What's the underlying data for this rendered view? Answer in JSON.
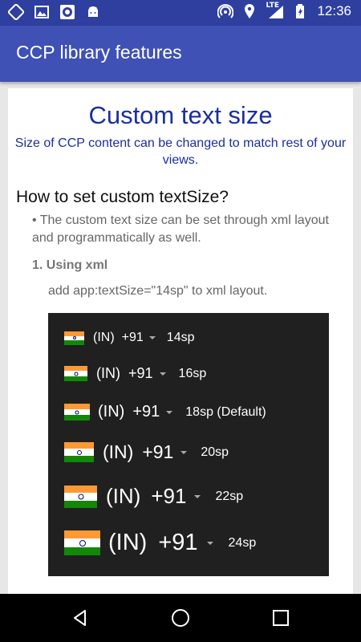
{
  "status_bar": {
    "time": "12:36",
    "network": "LTE",
    "left_icons": [
      "rotate-icon",
      "image-icon",
      "record-icon",
      "android-icon"
    ],
    "right_icons": [
      "hotspot-icon",
      "location-icon",
      "signal-icon",
      "battery-icon"
    ]
  },
  "app_bar": {
    "title": "CCP library features"
  },
  "content": {
    "heading": "Custom text size",
    "subheading": "Size of CCP content can be changed to match rest of your views.",
    "section_title": "How to set custom textSize?",
    "bullet": "• The custom text size can be set through xml layout and programmatically as well.",
    "step": "1. Using xml",
    "hint": "add app:textSize=\"14sp\" to xml layout."
  },
  "ccp_rows": [
    {
      "name_code": "(IN)",
      "phone_code": "+91",
      "size_label": "14sp"
    },
    {
      "name_code": "(IN)",
      "phone_code": "+91",
      "size_label": "16sp"
    },
    {
      "name_code": "(IN)",
      "phone_code": "+91",
      "size_label": "18sp (Default)"
    },
    {
      "name_code": "(IN)",
      "phone_code": "+91",
      "size_label": "20sp"
    },
    {
      "name_code": "(IN)",
      "phone_code": "+91",
      "size_label": "22sp"
    },
    {
      "name_code": "(IN)",
      "phone_code": "+91",
      "size_label": "24sp"
    }
  ],
  "colors": {
    "status_bar": "#2f3f9f",
    "app_bar": "#3f51b5",
    "heading": "#1a2fa0",
    "demo_panel": "#202020"
  },
  "nav_bar": {
    "buttons": [
      "back-icon",
      "home-icon",
      "recents-icon"
    ]
  }
}
